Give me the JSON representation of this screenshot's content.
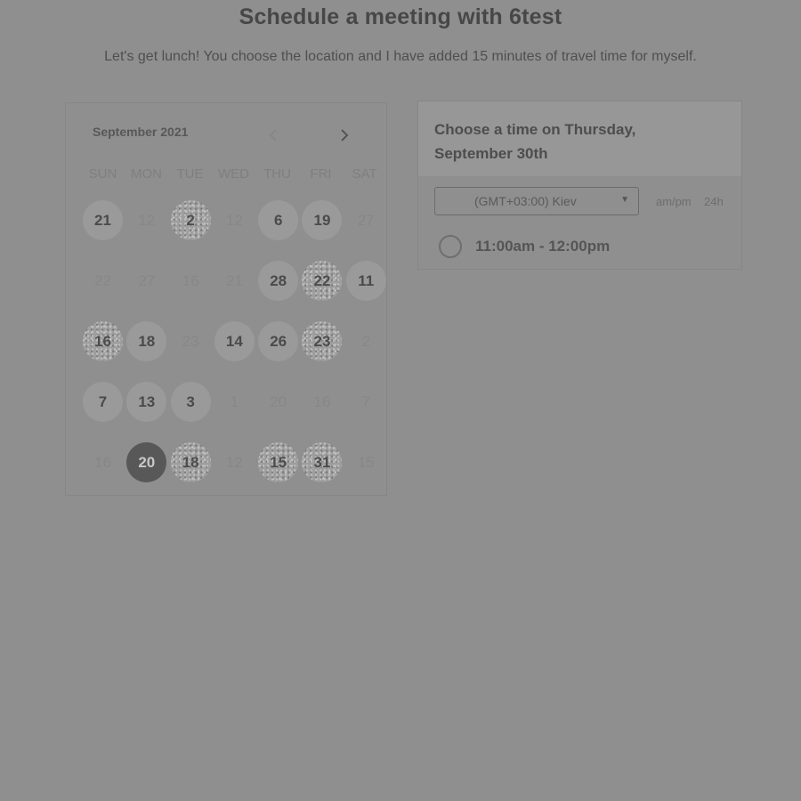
{
  "header": {
    "title": "Schedule a meeting with 6test",
    "subtitle": "Let's get lunch! You choose the location and I have added 15 minutes of travel time for myself."
  },
  "calendar": {
    "month_label": "September 2021",
    "prev_icon": "chevron-left-icon",
    "next_icon": "chevron-right-icon",
    "weekdays": [
      "SUN",
      "MON",
      "TUE",
      "WED",
      "THU",
      "FRI",
      "SAT"
    ],
    "weeks": [
      [
        {
          "label": "21",
          "state": "available"
        },
        {
          "label": "12",
          "state": "inactive"
        },
        {
          "label": "2",
          "state": "speckled"
        },
        {
          "label": "12",
          "state": "inactive"
        },
        {
          "label": "6",
          "state": "available"
        },
        {
          "label": "19",
          "state": "available"
        },
        {
          "label": "27",
          "state": "inactive"
        }
      ],
      [
        {
          "label": "22",
          "state": "inactive"
        },
        {
          "label": "27",
          "state": "inactive"
        },
        {
          "label": "16",
          "state": "inactive"
        },
        {
          "label": "21",
          "state": "inactive"
        },
        {
          "label": "28",
          "state": "available"
        },
        {
          "label": "22",
          "state": "speckled"
        },
        {
          "label": "11",
          "state": "available"
        }
      ],
      [
        {
          "label": "16",
          "state": "speckled"
        },
        {
          "label": "18",
          "state": "available"
        },
        {
          "label": "23",
          "state": "inactive"
        },
        {
          "label": "14",
          "state": "available"
        },
        {
          "label": "26",
          "state": "available"
        },
        {
          "label": "23",
          "state": "speckled"
        },
        {
          "label": "2",
          "state": "inactive"
        }
      ],
      [
        {
          "label": "7",
          "state": "available"
        },
        {
          "label": "13",
          "state": "available"
        },
        {
          "label": "3",
          "state": "available"
        },
        {
          "label": "1",
          "state": "inactive"
        },
        {
          "label": "20",
          "state": "inactive"
        },
        {
          "label": "16",
          "state": "inactive"
        },
        {
          "label": "7",
          "state": "inactive"
        }
      ],
      [
        {
          "label": "16",
          "state": "inactive"
        },
        {
          "label": "20",
          "state": "selected"
        },
        {
          "label": "18",
          "state": "speckled"
        },
        {
          "label": "12",
          "state": "inactive"
        },
        {
          "label": "15",
          "state": "speckled"
        },
        {
          "label": "31",
          "state": "speckled"
        },
        {
          "label": "15",
          "state": "inactive"
        }
      ]
    ]
  },
  "times": {
    "title": "Choose a time on Thursday, September 30th",
    "timezone": "(GMT+03:00) Kiev",
    "caret_icon": "caret-down-icon",
    "format_ampm": "am/pm",
    "format_24h": "24h",
    "slots": [
      {
        "label": "11:00am - 12:00pm"
      }
    ]
  },
  "colors": {
    "background": "#8f8f8f",
    "available_day": "#9a9a9a",
    "selected_day": "#585858"
  }
}
